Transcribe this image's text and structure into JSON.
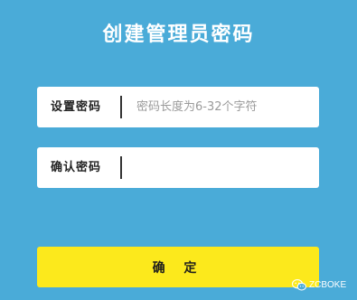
{
  "page": {
    "title": "创建管理员密码"
  },
  "form": {
    "password": {
      "label": "设置密码",
      "placeholder": "密码长度为6-32个字符",
      "value": ""
    },
    "confirm_password": {
      "label": "确认密码",
      "placeholder": "",
      "value": ""
    },
    "submit_label": "确 定"
  },
  "watermark": {
    "text": "ZCBOKE",
    "icon": "wechat-icon"
  },
  "colors": {
    "background": "#4aabd8",
    "button": "#fce91c",
    "field_background": "#ffffff",
    "title_text": "#ffffff"
  }
}
